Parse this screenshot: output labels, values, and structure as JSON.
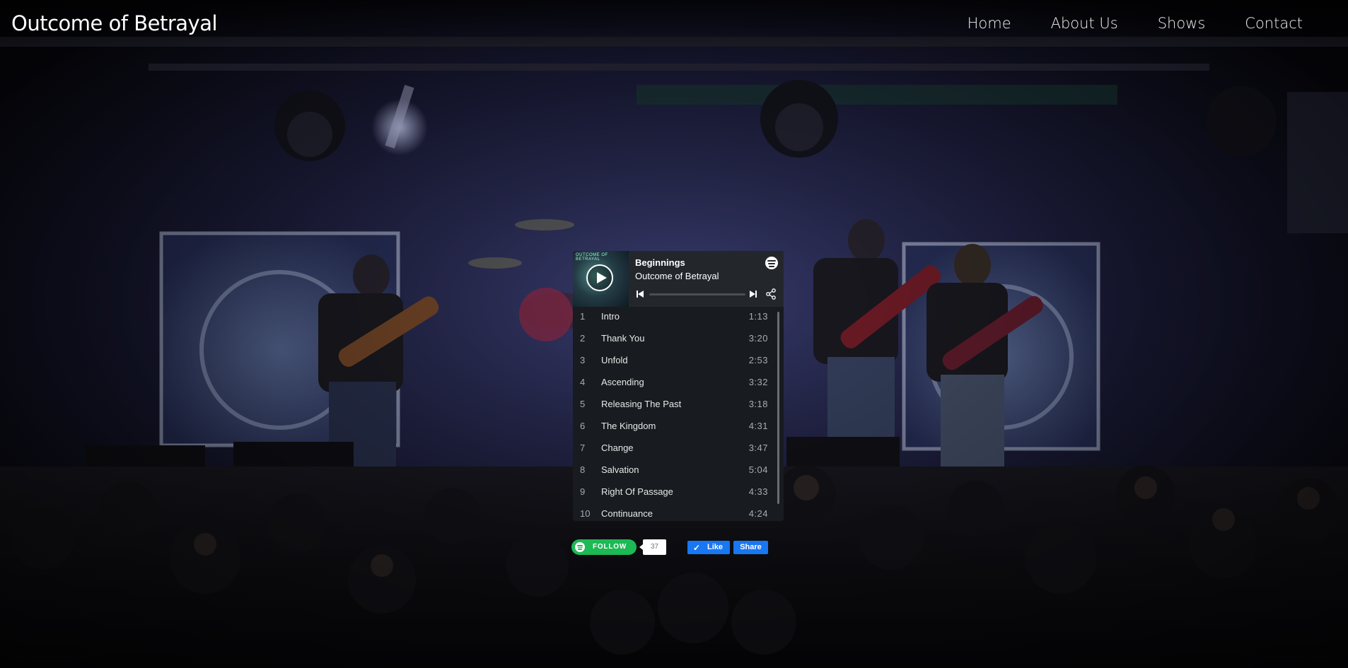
{
  "site": {
    "title": "Outcome of Betrayal"
  },
  "nav": {
    "items": [
      {
        "label": "Home"
      },
      {
        "label": "About Us"
      },
      {
        "label": "Shows"
      },
      {
        "label": "Contact"
      }
    ]
  },
  "player": {
    "album_title": "Beginnings",
    "artist": "Outcome of Betrayal",
    "cover_text": "OUTCOME OF BETRAYAL",
    "icons": [
      "play-icon",
      "spotify-logo-icon",
      "previous-track-icon",
      "next-track-icon",
      "share-icon"
    ],
    "tracks": [
      {
        "num": "1",
        "name": "Intro",
        "duration": "1:13"
      },
      {
        "num": "2",
        "name": "Thank You",
        "duration": "3:20"
      },
      {
        "num": "3",
        "name": "Unfold",
        "duration": "2:53"
      },
      {
        "num": "4",
        "name": "Ascending",
        "duration": "3:32"
      },
      {
        "num": "5",
        "name": "Releasing The Past",
        "duration": "3:18"
      },
      {
        "num": "6",
        "name": "The Kingdom",
        "duration": "4:31"
      },
      {
        "num": "7",
        "name": "Change",
        "duration": "3:47"
      },
      {
        "num": "8",
        "name": "Salvation",
        "duration": "5:04"
      },
      {
        "num": "9",
        "name": "Right Of Passage",
        "duration": "4:33"
      },
      {
        "num": "10",
        "name": "Continuance",
        "duration": "4:24"
      }
    ]
  },
  "social": {
    "follow_label": "FOLLOW",
    "follower_count": "37",
    "like_label": "Like",
    "share_label": "Share"
  },
  "colors": {
    "spotify_green": "#1db954",
    "facebook_blue": "#1877f2",
    "widget_bg": "#181b1f"
  }
}
